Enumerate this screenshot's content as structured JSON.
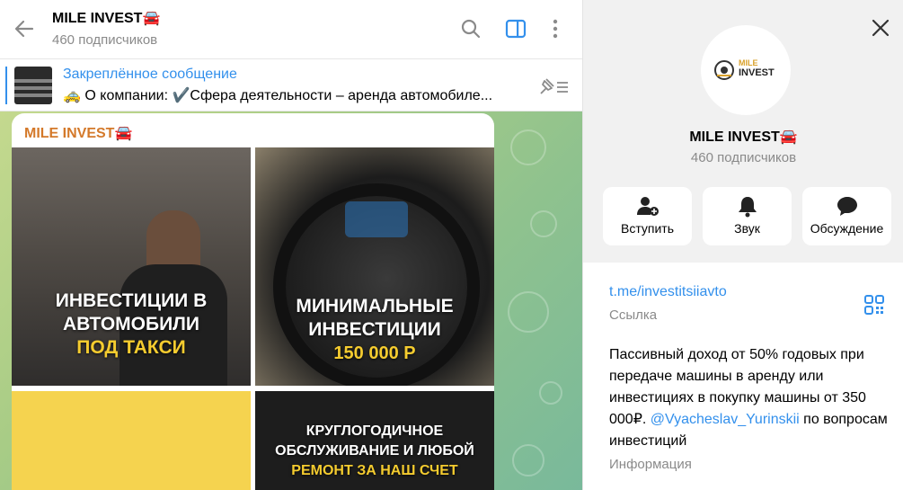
{
  "header": {
    "title": "MILE INVEST🚘",
    "subscribers": "460 подписчиков"
  },
  "pinned": {
    "title": "Закреплённое сообщение",
    "text": "🚕 О компании:  ✔️Сфера деятельности – аренда автомобиле..."
  },
  "message": {
    "author": "MILE INVEST🚘",
    "tiles": [
      {
        "line1": "ИНВЕСТИЦИИ В",
        "line2": "АВТОМОБИЛИ",
        "line3": "ПОД ТАКСИ"
      },
      {
        "line1": "МИНИМАЛЬНЫЕ",
        "line2": "ИНВЕСТИЦИИ",
        "line3": "150 000 Р"
      },
      {
        "line1": "",
        "line2": "",
        "line3": ""
      },
      {
        "line1": "КРУГЛОГОДИЧНОЕ",
        "line2": "ОБСЛУЖИВАНИЕ И ЛЮБОЙ",
        "line3": "РЕМОНТ ЗА НАШ СЧЕТ"
      }
    ]
  },
  "profile": {
    "name": "MILE INVEST🚘",
    "subscribers": "460 подписчиков",
    "logo_text_top": "MILE",
    "logo_text_bottom": "INVEST",
    "actions": [
      {
        "label": "Вступить",
        "icon": "add-user-icon"
      },
      {
        "label": "Звук",
        "icon": "bell-icon"
      },
      {
        "label": "Обсуждение",
        "icon": "chat-bubble-icon"
      }
    ],
    "link": "t.me/investitsiiavto",
    "link_label": "Ссылка",
    "description_before": "Пассивный доход от 50% годовых при передаче машины в аренду или инвестициях в покупку машины от 350 000₽. ",
    "description_mention": "@Vyacheslav_Yurinskii",
    "description_after": " по вопросам инвестиций",
    "description_label": "Информация"
  },
  "colors": {
    "accent": "#3390ec",
    "author": "#d4792a",
    "tile_yellow_text": "#f5cc2f"
  }
}
